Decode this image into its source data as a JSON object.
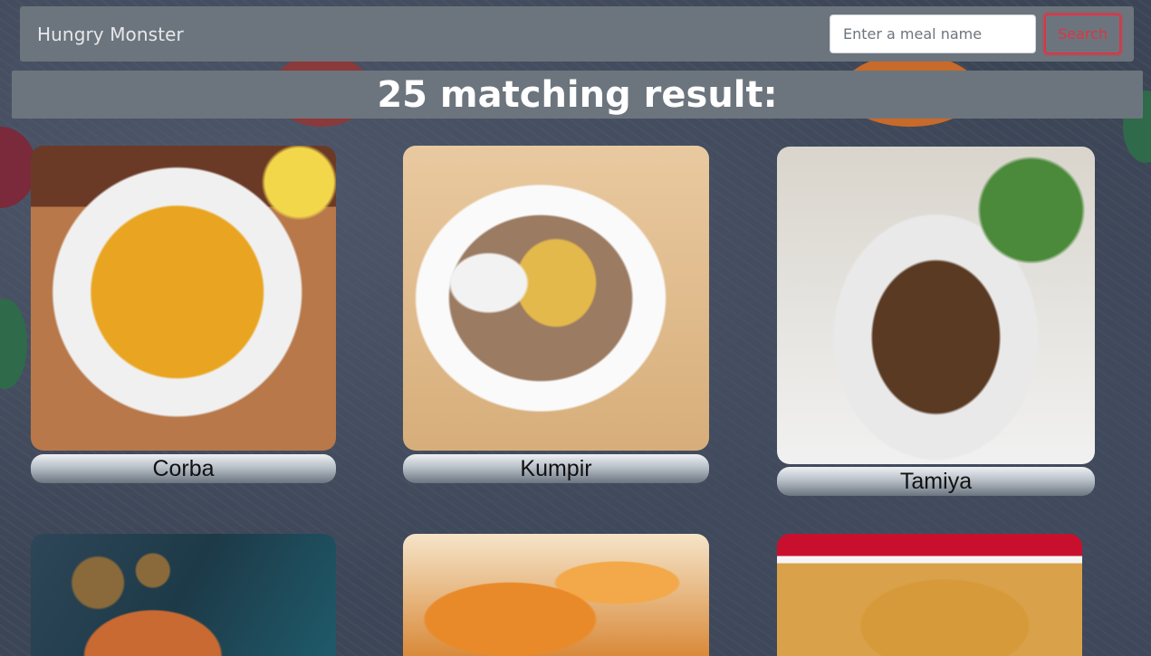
{
  "navbar": {
    "brand": "Hungry Monster",
    "search": {
      "placeholder": "Enter a meal name",
      "value": ""
    },
    "search_button": "Search"
  },
  "results": {
    "heading": "25 matching result:"
  },
  "meals": [
    {
      "name": "Corba"
    },
    {
      "name": "Kumpir"
    },
    {
      "name": "Tamiya"
    },
    {
      "name": ""
    },
    {
      "name": ""
    },
    {
      "name": ""
    }
  ],
  "colors": {
    "navbar": "#6c757d",
    "search_button": "#dc3545",
    "background": "#3c4556"
  }
}
